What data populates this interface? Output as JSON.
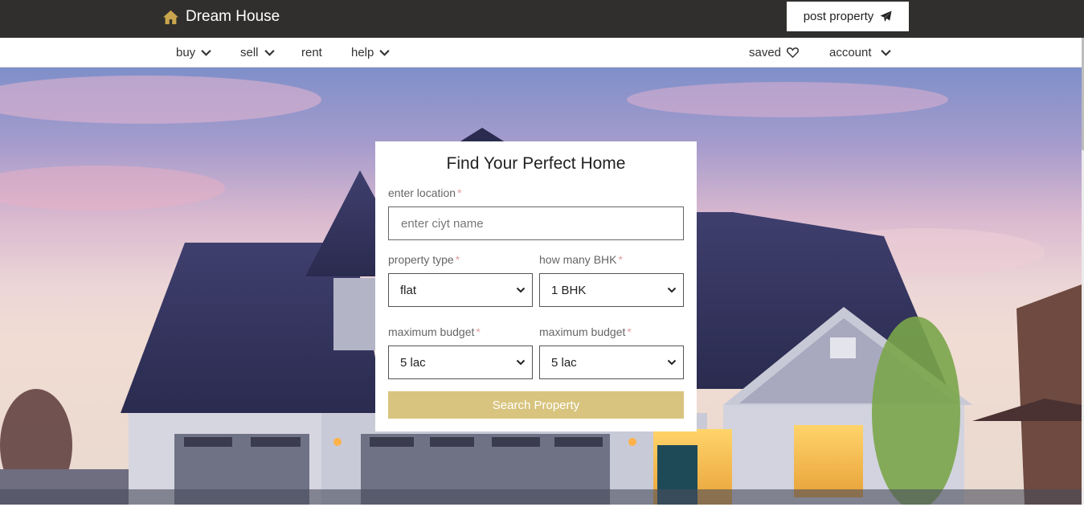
{
  "header": {
    "brand": "Dream House",
    "post_property_label": "post property"
  },
  "nav": {
    "buy": "buy",
    "sell": "sell",
    "rent": "rent",
    "help": "help",
    "saved": "saved",
    "account": "account"
  },
  "search_form": {
    "title": "Find Your Perfect Home",
    "location_label": "enter location",
    "location_placeholder": "enter ciyt name",
    "property_type_label": "property type",
    "property_type_value": "flat",
    "bhk_label": "how many BHK",
    "bhk_value": "1 BHK",
    "budget_label_1": "maximum budget",
    "budget_value_1": "5 lac",
    "budget_label_2": "maximum budget",
    "budget_value_2": "5 lac",
    "required_mark": "*",
    "submit_label": "Search Property"
  },
  "colors": {
    "topbar": "#302f2d",
    "accent": "#d8c47e",
    "brand_icon": "#c9a64d"
  }
}
